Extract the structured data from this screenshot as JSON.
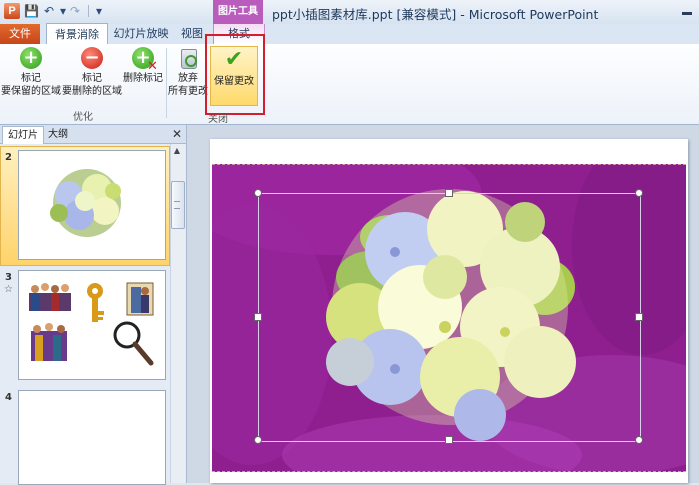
{
  "window": {
    "title": "ppt小插图素材库.ppt [兼容模式] - Microsoft PowerPoint",
    "app_logo": "P",
    "context_tab_title": "图片工具"
  },
  "quick_access": {
    "save_icon": "💾",
    "undo_icon": "↶",
    "redo_icon": "↷",
    "customize_icon": "▾"
  },
  "tabs": [
    {
      "label": "文件"
    },
    {
      "label": "背景消除"
    },
    {
      "label": "幻灯片放映"
    },
    {
      "label": "视图"
    },
    {
      "label": "格式"
    }
  ],
  "ribbon": {
    "mark_keep": {
      "line1": "标记",
      "line2": "要保留的区域",
      "icon": "+"
    },
    "mark_remove": {
      "line1": "标记",
      "line2": "要删除的区域",
      "icon": "−"
    },
    "delete_mark": {
      "label": "删除标记",
      "icon": "+"
    },
    "discard": {
      "line1": "放弃",
      "line2": "所有更改"
    },
    "keep_changes": {
      "label": "保留更改",
      "icon": "✔"
    },
    "group_refine": "优化",
    "group_close": "关闭"
  },
  "left_pane": {
    "tab_slides": "幻灯片",
    "tab_outline": "大纲",
    "close_icon": "✕",
    "slides": [
      {
        "number": "2"
      },
      {
        "number": "3",
        "marker": "☆"
      },
      {
        "number": "4"
      }
    ]
  },
  "colors": {
    "accent_orange": "#c8451b",
    "picture_tools": "#b95dbd",
    "slide_bg_purple": "#8f1e8f",
    "highlight_red": "#d21f2b"
  }
}
